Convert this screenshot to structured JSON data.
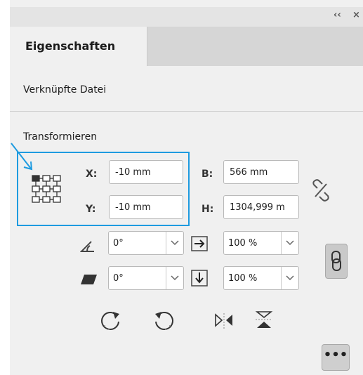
{
  "window": {
    "collapse_label": "‹‹",
    "close_label": "×"
  },
  "tabs": [
    {
      "label": "Eigenschaften"
    }
  ],
  "section_linked": {
    "title": "Verknüpfte Datei"
  },
  "transform": {
    "title": "Transformieren",
    "x": {
      "label": "X:",
      "value": "-10 mm"
    },
    "y": {
      "label": "Y:",
      "value": "-10 mm"
    },
    "w": {
      "label": "B:",
      "value": "566 mm"
    },
    "h": {
      "label": "H:",
      "value": "1304,999 m"
    },
    "rotation": {
      "value": "0°"
    },
    "shear": {
      "value": "0°"
    },
    "scale_x": {
      "value": "100 %"
    },
    "scale_y": {
      "value": "100 %"
    }
  },
  "more_label": "•••",
  "colors": {
    "accent": "#1e9be0",
    "panel_bg": "#f0f0f0",
    "tab_bar": "#d6d6d6"
  }
}
